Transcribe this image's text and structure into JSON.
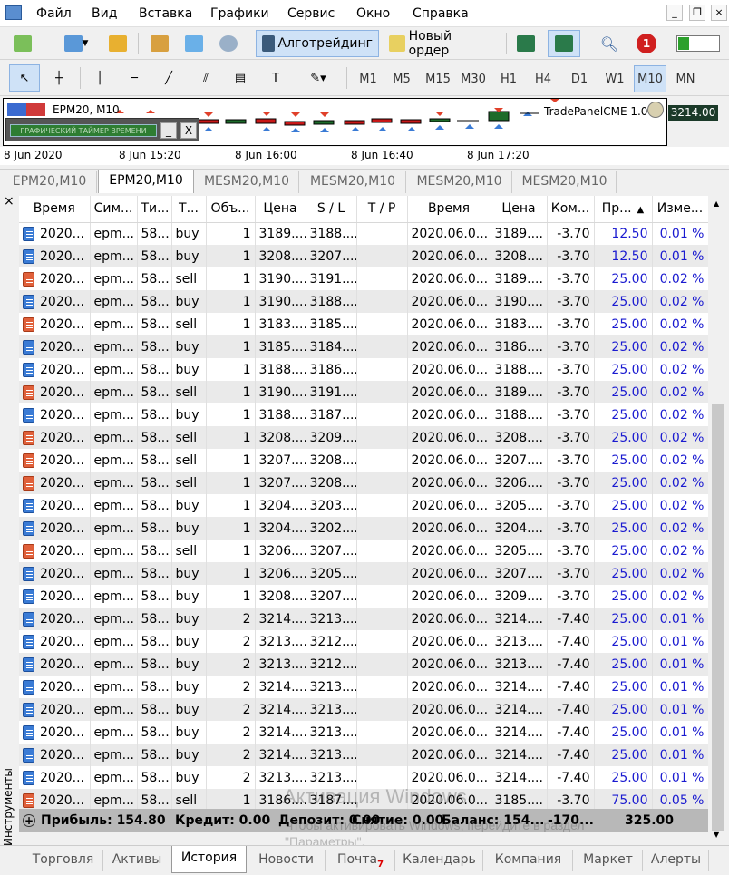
{
  "menu": [
    "Файл",
    "Вид",
    "Вставка",
    "Графики",
    "Сервис",
    "Окно",
    "Справка"
  ],
  "toolbar": {
    "algotrading_label": "Алготрейдинг",
    "new_order_label": "Новый ордер",
    "notification_count": "1"
  },
  "timeframes": [
    "M1",
    "M5",
    "M15",
    "M30",
    "H1",
    "H4",
    "D1",
    "W1",
    "M10",
    "MN"
  ],
  "active_timeframe": "M10",
  "chart": {
    "symbol_label": "EPM20, M10",
    "indicator_label": "TradePanelCME 1.07",
    "price": "3214.00",
    "timer_label": "ГРАФИЧЕСКИЙ ТАЙМЕР ВРЕМЕНИ",
    "min_btn": "_",
    "close_btn": "X"
  },
  "time_axis": [
    "8 Jun 2020",
    "8 Jun 15:20",
    "8 Jun 16:00",
    "8 Jun 16:40",
    "8 Jun 17:20"
  ],
  "chart_tabs": [
    "EPM20,M10",
    "EPM20,M10",
    "MESM20,M10",
    "MESM20,M10",
    "MESM20,M10",
    "MESM20,M10"
  ],
  "active_chart_tab": 1,
  "side_label": "Инструменты",
  "close_icon": "×",
  "columns": [
    "Время",
    "Сим...",
    "Ти...",
    "Т...",
    "Объ...",
    "Цена",
    "S / L",
    "T / P",
    "Время",
    "Цена",
    "Ком...",
    "Пр...",
    "Изме..."
  ],
  "sort_indicator": "▲",
  "rows": [
    [
      "2020...",
      "epm...",
      "58...",
      "buy",
      "1",
      "3189....",
      "3188....",
      "",
      "2020.06.0...",
      "3189....",
      "-3.70",
      "12.50",
      "0.01 %"
    ],
    [
      "2020...",
      "epm...",
      "58...",
      "buy",
      "1",
      "3208....",
      "3207....",
      "",
      "2020.06.0...",
      "3208....",
      "-3.70",
      "12.50",
      "0.01 %"
    ],
    [
      "2020...",
      "epm...",
      "58...",
      "sell",
      "1",
      "3190....",
      "3191....",
      "",
      "2020.06.0...",
      "3189....",
      "-3.70",
      "25.00",
      "0.02 %"
    ],
    [
      "2020...",
      "epm...",
      "58...",
      "buy",
      "1",
      "3190....",
      "3188....",
      "",
      "2020.06.0...",
      "3190....",
      "-3.70",
      "25.00",
      "0.02 %"
    ],
    [
      "2020...",
      "epm...",
      "58...",
      "sell",
      "1",
      "3183....",
      "3185....",
      "",
      "2020.06.0...",
      "3183....",
      "-3.70",
      "25.00",
      "0.02 %"
    ],
    [
      "2020...",
      "epm...",
      "58...",
      "buy",
      "1",
      "3185....",
      "3184....",
      "",
      "2020.06.0...",
      "3186....",
      "-3.70",
      "25.00",
      "0.02 %"
    ],
    [
      "2020...",
      "epm...",
      "58...",
      "buy",
      "1",
      "3188....",
      "3186....",
      "",
      "2020.06.0...",
      "3188....",
      "-3.70",
      "25.00",
      "0.02 %"
    ],
    [
      "2020...",
      "epm...",
      "58...",
      "sell",
      "1",
      "3190....",
      "3191....",
      "",
      "2020.06.0...",
      "3189....",
      "-3.70",
      "25.00",
      "0.02 %"
    ],
    [
      "2020...",
      "epm...",
      "58...",
      "buy",
      "1",
      "3188....",
      "3187....",
      "",
      "2020.06.0...",
      "3188....",
      "-3.70",
      "25.00",
      "0.02 %"
    ],
    [
      "2020...",
      "epm...",
      "58...",
      "sell",
      "1",
      "3208....",
      "3209....",
      "",
      "2020.06.0...",
      "3208....",
      "-3.70",
      "25.00",
      "0.02 %"
    ],
    [
      "2020...",
      "epm...",
      "58...",
      "sell",
      "1",
      "3207....",
      "3208....",
      "",
      "2020.06.0...",
      "3207....",
      "-3.70",
      "25.00",
      "0.02 %"
    ],
    [
      "2020...",
      "epm...",
      "58...",
      "sell",
      "1",
      "3207....",
      "3208....",
      "",
      "2020.06.0...",
      "3206....",
      "-3.70",
      "25.00",
      "0.02 %"
    ],
    [
      "2020...",
      "epm...",
      "58...",
      "buy",
      "1",
      "3204....",
      "3203....",
      "",
      "2020.06.0...",
      "3205....",
      "-3.70",
      "25.00",
      "0.02 %"
    ],
    [
      "2020...",
      "epm...",
      "58...",
      "buy",
      "1",
      "3204....",
      "3202....",
      "",
      "2020.06.0...",
      "3204....",
      "-3.70",
      "25.00",
      "0.02 %"
    ],
    [
      "2020...",
      "epm...",
      "58...",
      "sell",
      "1",
      "3206....",
      "3207....",
      "",
      "2020.06.0...",
      "3205....",
      "-3.70",
      "25.00",
      "0.02 %"
    ],
    [
      "2020...",
      "epm...",
      "58...",
      "buy",
      "1",
      "3206....",
      "3205....",
      "",
      "2020.06.0...",
      "3207....",
      "-3.70",
      "25.00",
      "0.02 %"
    ],
    [
      "2020...",
      "epm...",
      "58...",
      "buy",
      "1",
      "3208....",
      "3207....",
      "",
      "2020.06.0...",
      "3209....",
      "-3.70",
      "25.00",
      "0.02 %"
    ],
    [
      "2020...",
      "epm...",
      "58...",
      "buy",
      "2",
      "3214....",
      "3213....",
      "",
      "2020.06.0...",
      "3214....",
      "-7.40",
      "25.00",
      "0.01 %"
    ],
    [
      "2020...",
      "epm...",
      "58...",
      "buy",
      "2",
      "3213....",
      "3212....",
      "",
      "2020.06.0...",
      "3213....",
      "-7.40",
      "25.00",
      "0.01 %"
    ],
    [
      "2020...",
      "epm...",
      "58...",
      "buy",
      "2",
      "3213....",
      "3212....",
      "",
      "2020.06.0...",
      "3213....",
      "-7.40",
      "25.00",
      "0.01 %"
    ],
    [
      "2020...",
      "epm...",
      "58...",
      "buy",
      "2",
      "3214....",
      "3213....",
      "",
      "2020.06.0...",
      "3214....",
      "-7.40",
      "25.00",
      "0.01 %"
    ],
    [
      "2020...",
      "epm...",
      "58...",
      "buy",
      "2",
      "3214....",
      "3213....",
      "",
      "2020.06.0...",
      "3214....",
      "-7.40",
      "25.00",
      "0.01 %"
    ],
    [
      "2020...",
      "epm...",
      "58...",
      "buy",
      "2",
      "3214....",
      "3213....",
      "",
      "2020.06.0...",
      "3214....",
      "-7.40",
      "25.00",
      "0.01 %"
    ],
    [
      "2020...",
      "epm...",
      "58...",
      "buy",
      "2",
      "3214....",
      "3213....",
      "",
      "2020.06.0...",
      "3214....",
      "-7.40",
      "25.00",
      "0.01 %"
    ],
    [
      "2020...",
      "epm...",
      "58...",
      "buy",
      "2",
      "3213....",
      "3213....",
      "",
      "2020.06.0...",
      "3214....",
      "-7.40",
      "25.00",
      "0.01 %"
    ],
    [
      "2020...",
      "epm...",
      "58...",
      "sell",
      "1",
      "3186....",
      "3187....",
      "",
      "2020.06.0...",
      "3185....",
      "-3.70",
      "75.00",
      "0.05 %"
    ]
  ],
  "summary": {
    "profit": "Прибыль: 154.80",
    "credit": "Кредит: 0.00",
    "deposit": "Депозит: 0.00",
    "withdraw": "Снятие: 0.00",
    "balance": "Баланс: 154...",
    "commission": "-170...",
    "total": "325.00"
  },
  "watermark": {
    "title": "Активация Windows",
    "subtitle": "Чтобы активировать Windows, перейдите в раздел",
    "subtitle2": "\"Параметры\"."
  },
  "bottom_tabs": [
    "Торговля",
    "Активы",
    "История",
    "Новости",
    "Почта",
    "Календарь",
    "Компания",
    "Маркет",
    "Алерты"
  ],
  "mail_badge": "7",
  "active_bottom_tab": 2
}
